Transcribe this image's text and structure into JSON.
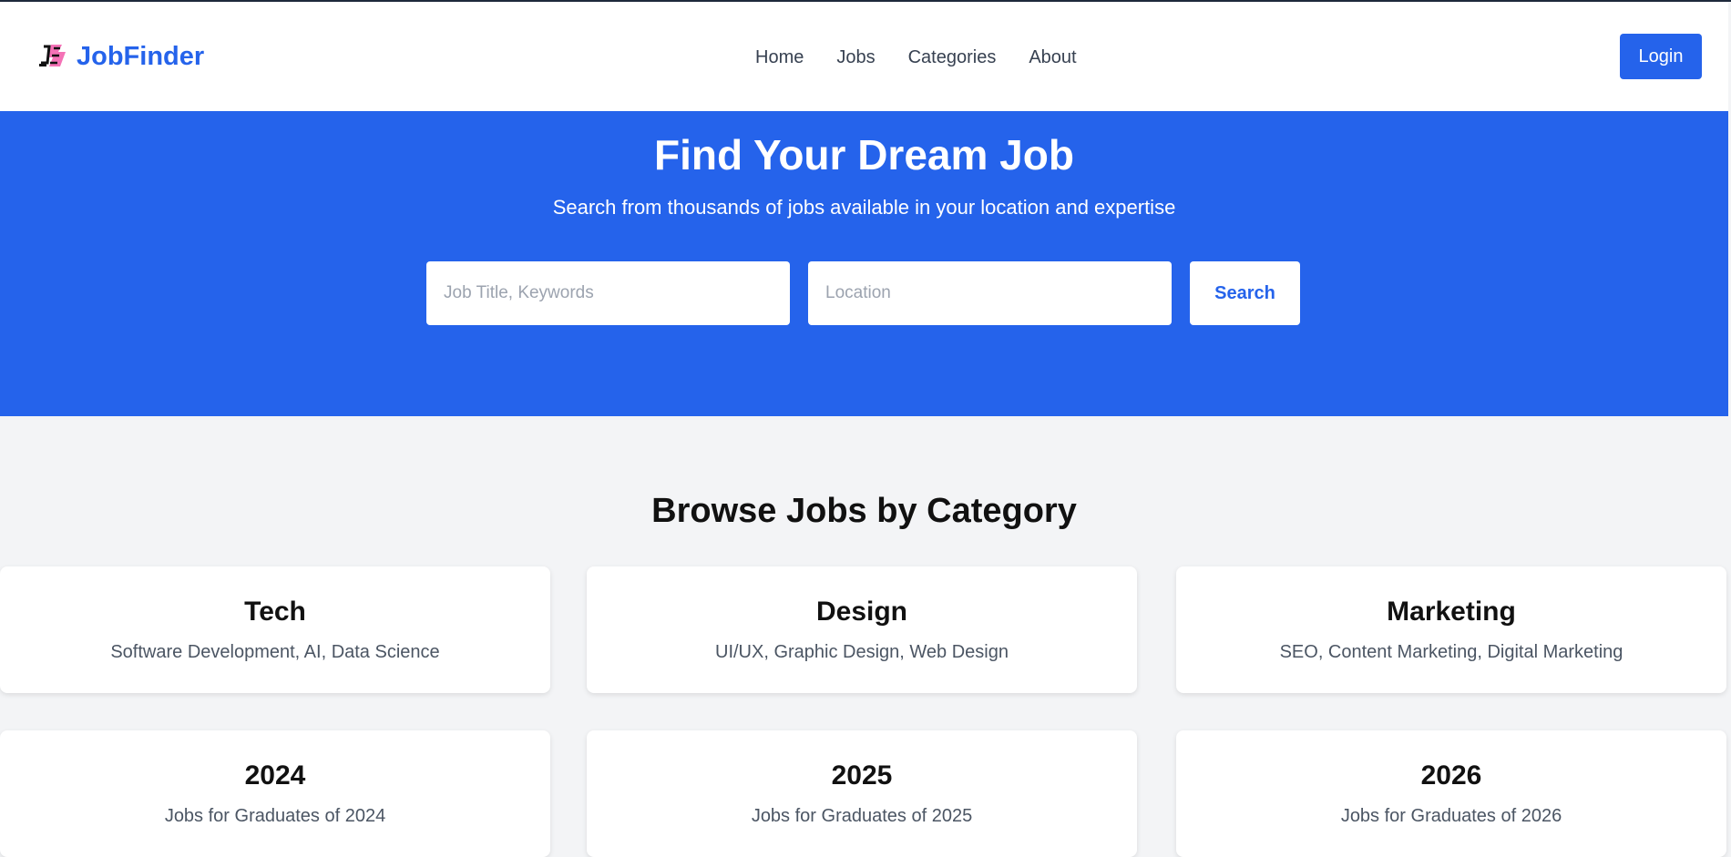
{
  "header": {
    "logo_text": "JobFinder",
    "nav": [
      "Home",
      "Jobs",
      "Categories",
      "About"
    ],
    "login_label": "Login"
  },
  "hero": {
    "title": "Find Your Dream Job",
    "subtitle": "Search from thousands of jobs available in your location and expertise",
    "job_placeholder": "Job Title, Keywords",
    "location_placeholder": "Location",
    "search_label": "Search"
  },
  "categories": {
    "title": "Browse Jobs by Category",
    "items": [
      {
        "title": "Tech",
        "desc": "Software Development, AI, Data Science"
      },
      {
        "title": "Design",
        "desc": "UI/UX, Graphic Design, Web Design"
      },
      {
        "title": "Marketing",
        "desc": "SEO, Content Marketing, Digital Marketing"
      },
      {
        "title": "2024",
        "desc": "Jobs for Graduates of 2024"
      },
      {
        "title": "2025",
        "desc": "Jobs for Graduates of 2025"
      },
      {
        "title": "2026",
        "desc": "Jobs for Graduates of 2026"
      }
    ]
  },
  "colors": {
    "primary": "#2563eb",
    "page_background": "#f3f4f6",
    "card_background": "#ffffff",
    "logo_icon_pink": "#f472b6"
  },
  "icons": {
    "logo": "js-logo-icon"
  }
}
